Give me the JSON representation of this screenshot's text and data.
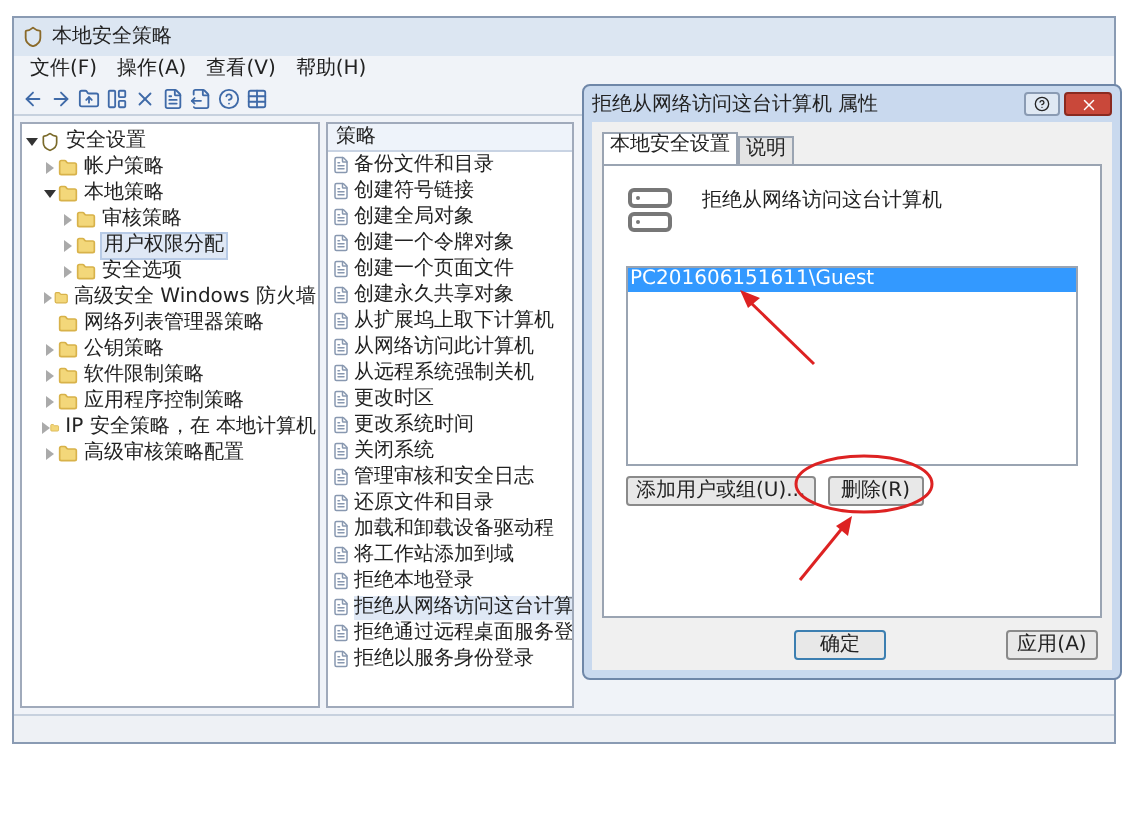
{
  "main_window": {
    "title": "本地安全策略",
    "menu": [
      "文件(F)",
      "操作(A)",
      "查看(V)",
      "帮助(H)"
    ],
    "tree": [
      {
        "label": "安全设置",
        "expanded": true,
        "selected": false,
        "children": [
          {
            "label": "帐户策略",
            "expanded": false,
            "selected": false
          },
          {
            "label": "本地策略",
            "expanded": true,
            "selected": false,
            "children": [
              {
                "label": "审核策略",
                "expanded": false,
                "selected": false
              },
              {
                "label": "用户权限分配",
                "expanded": false,
                "selected": true
              },
              {
                "label": "安全选项",
                "expanded": false,
                "selected": false
              }
            ]
          },
          {
            "label": "高级安全 Windows 防火墙",
            "expanded": false,
            "selected": false
          },
          {
            "label": "网络列表管理器策略",
            "selected": false
          },
          {
            "label": "公钥策略",
            "expanded": false,
            "selected": false
          },
          {
            "label": "软件限制策略",
            "expanded": false,
            "selected": false
          },
          {
            "label": "应用程序控制策略",
            "expanded": false,
            "selected": false
          },
          {
            "label": "IP 安全策略，在 本地计算机",
            "expanded": false,
            "selected": false
          },
          {
            "label": "高级审核策略配置",
            "expanded": false,
            "selected": false
          }
        ]
      }
    ],
    "list": {
      "column": "策略",
      "rows": [
        {
          "label": "备份文件和目录",
          "selected": false
        },
        {
          "label": "创建符号链接",
          "selected": false
        },
        {
          "label": "创建全局对象",
          "selected": false
        },
        {
          "label": "创建一个令牌对象",
          "selected": false
        },
        {
          "label": "创建一个页面文件",
          "selected": false
        },
        {
          "label": "创建永久共享对象",
          "selected": false
        },
        {
          "label": "从扩展坞上取下计算机",
          "selected": false
        },
        {
          "label": "从网络访问此计算机",
          "selected": false
        },
        {
          "label": "从远程系统强制关机",
          "selected": false
        },
        {
          "label": "更改时区",
          "selected": false
        },
        {
          "label": "更改系统时间",
          "selected": false
        },
        {
          "label": "关闭系统",
          "selected": false
        },
        {
          "label": "管理审核和安全日志",
          "selected": false
        },
        {
          "label": "还原文件和目录",
          "selected": false
        },
        {
          "label": "加载和卸载设备驱动程",
          "selected": false
        },
        {
          "label": "将工作站添加到域",
          "selected": false
        },
        {
          "label": "拒绝本地登录",
          "selected": false
        },
        {
          "label": "拒绝从网络访问这台计算",
          "selected": true
        },
        {
          "label": "拒绝通过远程桌面服务登",
          "selected": false
        },
        {
          "label": "拒绝以服务身份登录",
          "selected": false
        }
      ]
    }
  },
  "dialog": {
    "title": "拒绝从网络访问这台计算机 属性",
    "tabs": [
      {
        "label": "本地安全设置",
        "selected": true
      },
      {
        "label": "说明",
        "selected": false
      }
    ],
    "policy_name": "拒绝从网络访问这台计算机",
    "accounts": [
      {
        "label": "PC201606151611\\Guest",
        "selected": true
      }
    ],
    "add_button": "添加用户或组(U)...",
    "remove_button": "删除(R)",
    "ok_button": "确定",
    "apply_button": "应用(A)"
  }
}
